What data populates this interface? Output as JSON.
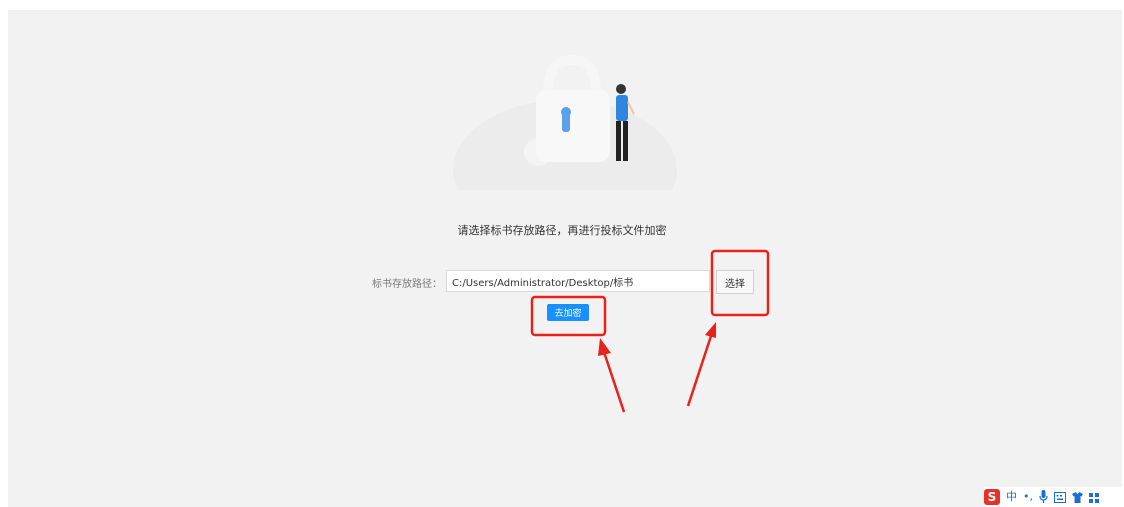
{
  "prompt": {
    "text": "请选择标书存放路径，再进行投标文件加密"
  },
  "path": {
    "label": "标书存放路径：",
    "value": "C:/Users/Administrator/Desktop/标书"
  },
  "buttons": {
    "select_label": "选择",
    "encrypt_label": "去加密"
  },
  "ime_toolbar": {
    "logo": "S",
    "mode_label": "中",
    "icons": [
      "punctuation-icon",
      "microphone-icon",
      "keyboard-icon",
      "skin-icon",
      "toolbox-icon"
    ]
  },
  "colors": {
    "primary": "#1890ff",
    "annotation_red": "#e8211a",
    "background": "#f2f2f2",
    "ime_logo": "#e4322b"
  }
}
